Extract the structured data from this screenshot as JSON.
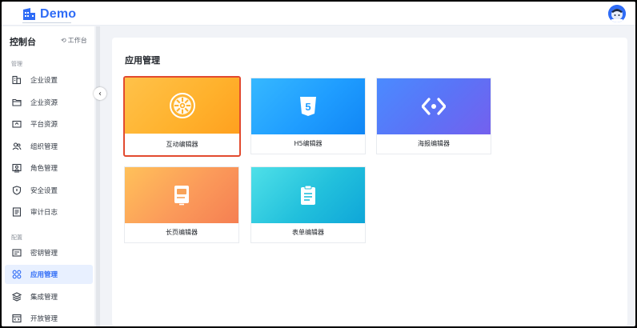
{
  "app": {
    "logo_text": "Demo"
  },
  "sidebar": {
    "title": "控制台",
    "workbench_label": "工作台",
    "groups": [
      {
        "label": "管理"
      },
      {
        "label": "配置"
      }
    ],
    "items": [
      {
        "label": "企业设置",
        "icon": "building-icon"
      },
      {
        "label": "企业资源",
        "icon": "folder-icon"
      },
      {
        "label": "平台资源",
        "icon": "folder-upload-icon"
      },
      {
        "label": "组织管理",
        "icon": "users-icon"
      },
      {
        "label": "角色管理",
        "icon": "id-card-icon"
      },
      {
        "label": "安全设置",
        "icon": "shield-icon"
      },
      {
        "label": "审计日志",
        "icon": "log-icon"
      },
      {
        "label": "密钥管理",
        "icon": "key-icon"
      },
      {
        "label": "应用管理",
        "icon": "apps-icon",
        "active": true
      },
      {
        "label": "集成管理",
        "icon": "layers-icon"
      },
      {
        "label": "开放管理",
        "icon": "code-icon"
      }
    ]
  },
  "main": {
    "title": "应用管理",
    "cards": [
      {
        "label": "互动编辑器",
        "selected": true,
        "icon": "wheel-icon"
      },
      {
        "label": "H5编辑器",
        "icon": "html5-icon"
      },
      {
        "label": "海报编辑器",
        "icon": "code-brackets-icon"
      },
      {
        "label": "长页编辑器",
        "icon": "document-icon"
      },
      {
        "label": "表单编辑器",
        "icon": "clipboard-icon"
      }
    ]
  },
  "colors": {
    "accent": "#2f6cf6",
    "selected_border": "#e24a2f",
    "orange": "#ffae2a",
    "blue": "#1f9dff",
    "purple": "#6b62f0",
    "coral": "#f57f52",
    "teal": "#22c0dc"
  }
}
